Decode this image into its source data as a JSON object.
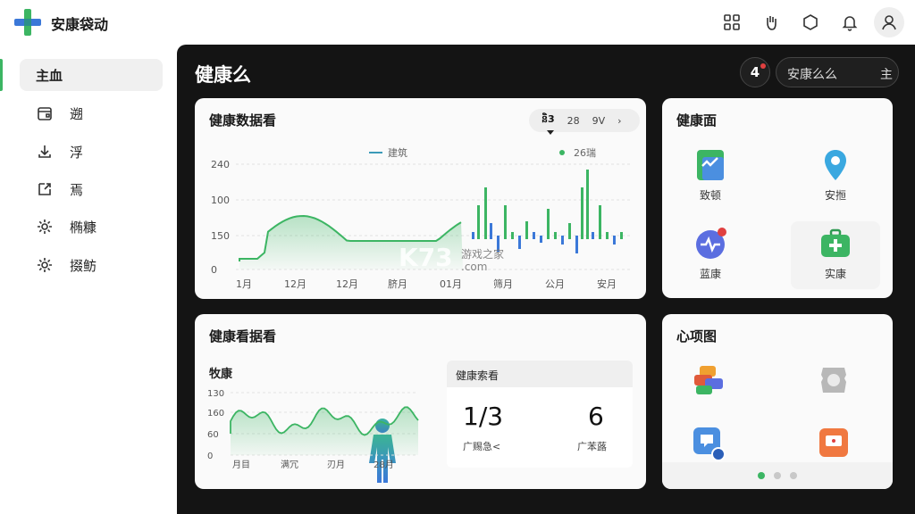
{
  "app": {
    "title": "安康袋动"
  },
  "sidebar": {
    "items": [
      {
        "label": "主血",
        "icon": "home-icon"
      },
      {
        "label": "遡",
        "icon": "calendar-icon"
      },
      {
        "label": "浮",
        "icon": "download-icon"
      },
      {
        "label": "焉",
        "icon": "export-icon"
      },
      {
        "label": "椭糠",
        "icon": "gear-icon"
      },
      {
        "label": "掇鲂",
        "icon": "settings-icon"
      }
    ]
  },
  "main": {
    "title": "健康么",
    "notification_badge": "4",
    "search_text": "安康么么",
    "search_button": "主"
  },
  "card_overview": {
    "title": "健康数据看",
    "range_options": [
      "និ3",
      "28",
      "9V"
    ],
    "range_arrow": "›",
    "legend": [
      "建筑",
      "26瑞"
    ],
    "y_ticks": [
      "240",
      "100",
      "150",
      "0"
    ],
    "x_ticks": [
      "1月",
      "12月",
      "12月",
      "脐月",
      "01月",
      "筛月",
      "公月",
      "安月"
    ]
  },
  "card_apps": {
    "title": "健康面",
    "tiles": [
      {
        "label": "致顿",
        "icon": "document-chart-icon"
      },
      {
        "label": "安搄",
        "icon": "location-pin-icon"
      },
      {
        "label": "蓝康",
        "icon": "heartbeat-icon"
      },
      {
        "label": "实康",
        "icon": "medical-kit-icon"
      }
    ]
  },
  "card_trend": {
    "title": "健康看据看",
    "subtitle": "牧康",
    "y_ticks": [
      "130",
      "160",
      "60",
      "0"
    ],
    "x_ticks": [
      "月目",
      "满冗",
      "刃月",
      "28月"
    ],
    "stats_title": "健康索看",
    "stats": [
      {
        "value": "1/3",
        "label": "广赐急<"
      },
      {
        "value": "6",
        "label": "广苯蕗"
      }
    ]
  },
  "card_grid": {
    "title": "心项图",
    "tiles": [
      {
        "icon": "layers-icon"
      },
      {
        "icon": "gear-shape-icon"
      },
      {
        "icon": "chat-bubble-icon"
      },
      {
        "icon": "message-icon"
      }
    ]
  },
  "watermark": {
    "brand": "K73",
    "sub": "游戏之家",
    "domain": ".com"
  },
  "colors": {
    "accent": "#3cb563",
    "blue": "#3b78d8",
    "dark": "#141414"
  }
}
